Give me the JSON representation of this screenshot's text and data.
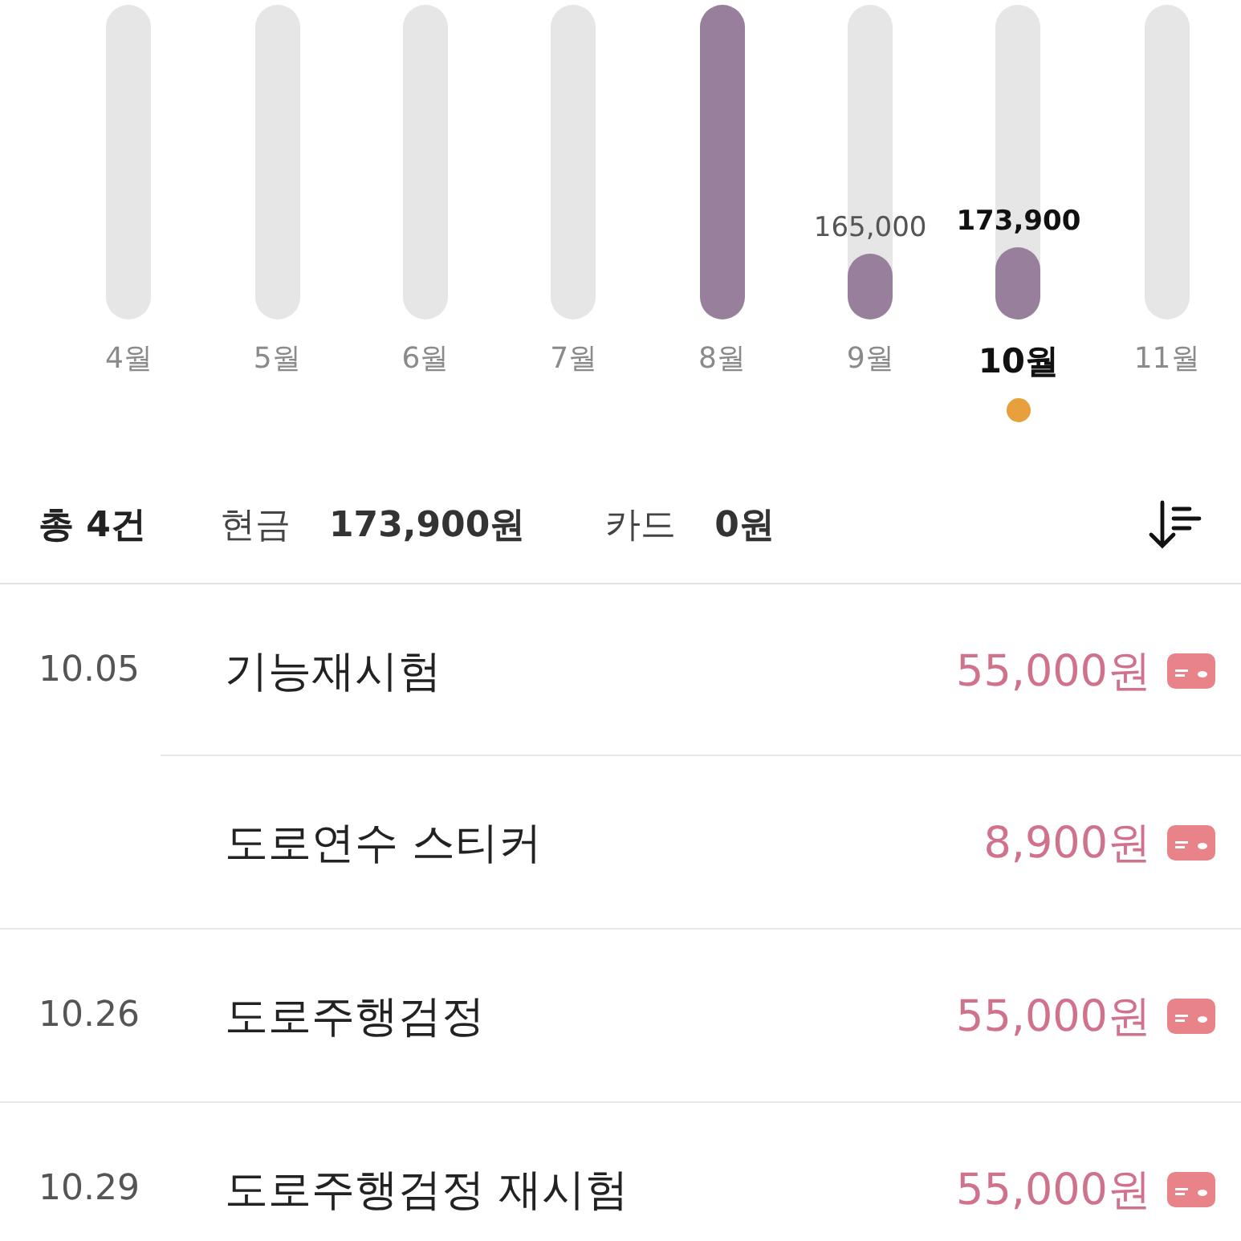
{
  "months": [
    {
      "label": "4월",
      "selected": false
    },
    {
      "label": "5월",
      "selected": false
    },
    {
      "label": "6월",
      "selected": false
    },
    {
      "label": "7월",
      "selected": false
    },
    {
      "label": "8월",
      "selected": false,
      "level": 1
    },
    {
      "label": "9월",
      "selected": false,
      "level": 0.21,
      "value_label": "165,000"
    },
    {
      "label": "10월",
      "selected": true,
      "level": 0.23,
      "value_label": "173,900"
    },
    {
      "label": "11월",
      "selected": false
    }
  ],
  "summary": {
    "total": "총 4건",
    "cash_label": "현금",
    "cash_amount": "173,900원",
    "card_label": "카드",
    "card_amount": "0원"
  },
  "transactions": [
    {
      "date": "10.05",
      "title": "기능재시험",
      "amount": "55,000원"
    },
    {
      "title": "도로연수 스티커",
      "amount": "8,900원"
    },
    {
      "date": "10.26",
      "title": "도로주행검정",
      "amount": "55,000원"
    },
    {
      "date": "10.29",
      "title": "도로주행검정 재시험",
      "amount": "55,000원"
    }
  ]
}
